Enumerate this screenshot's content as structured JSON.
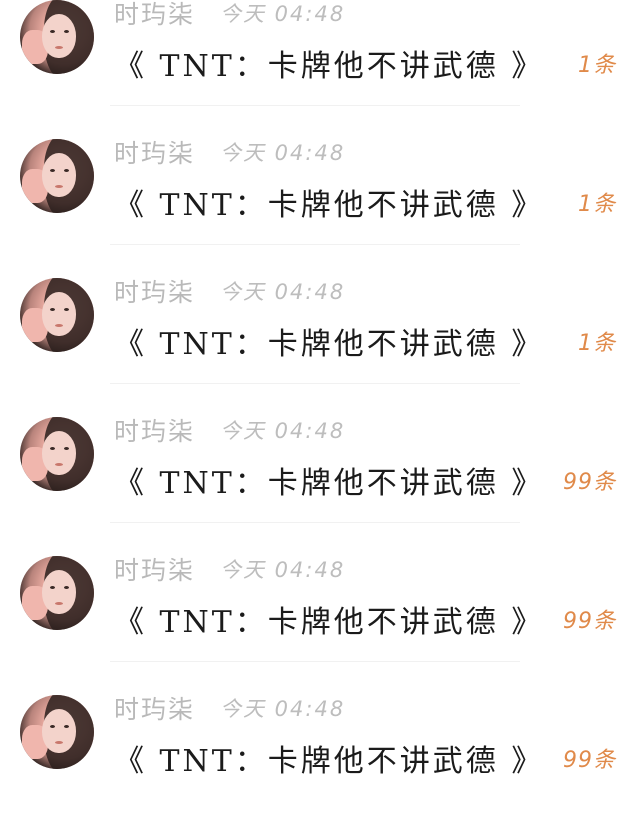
{
  "messages": [
    {
      "sender": "时玙柒",
      "time": "今天 04:48",
      "title": "《 TNT：卡牌他不讲武德 》",
      "count": "1条"
    },
    {
      "sender": "时玙柒",
      "time": "今天 04:48",
      "title": "《 TNT：卡牌他不讲武德 》",
      "count": "1条"
    },
    {
      "sender": "时玙柒",
      "time": "今天 04:48",
      "title": "《 TNT：卡牌他不讲武德 》",
      "count": "1条"
    },
    {
      "sender": "时玙柒",
      "time": "今天 04:48",
      "title": "《 TNT：卡牌他不讲武德 》",
      "count": "99条"
    },
    {
      "sender": "时玙柒",
      "time": "今天 04:48",
      "title": "《 TNT：卡牌他不讲武德 》",
      "count": "99条"
    },
    {
      "sender": "时玙柒",
      "time": "今天 04:48",
      "title": "《 TNT：卡牌他不讲武德 》",
      "count": "99条"
    }
  ],
  "colors": {
    "name": "#b9b9b9",
    "time": "#bdbdbd",
    "title": "#1b1b1b",
    "count": "#e08a4a"
  }
}
